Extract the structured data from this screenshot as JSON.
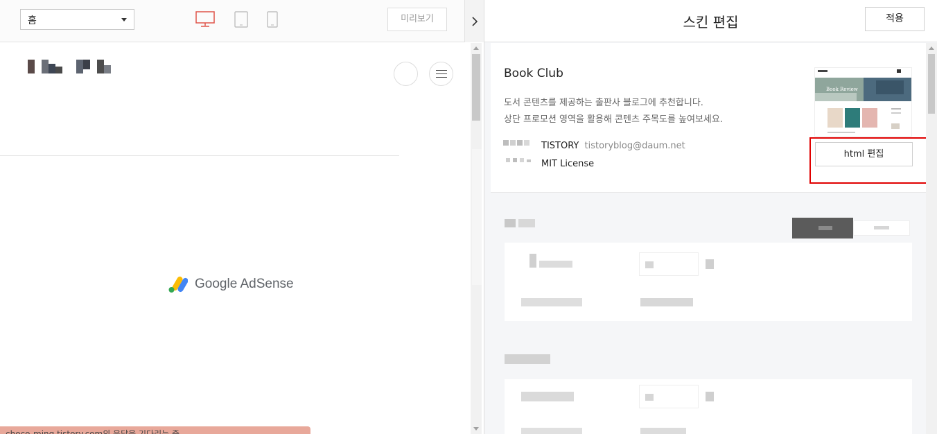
{
  "toolbar": {
    "page_select_value": "홈",
    "preview_label": "미리보기",
    "device_icons": [
      "desktop-icon",
      "tablet-icon",
      "mobile-icon"
    ],
    "active_device_color": "#e0544a",
    "collapse_icon": "chevron-right-icon"
  },
  "preview": {
    "ad_brand": "Google AdSense",
    "toast_text": "choco-ming.tistory.com의 응답을 기다리는 중..."
  },
  "editor": {
    "title": "스킨 편집",
    "apply_label": "적용",
    "skin": {
      "name": "Book Club",
      "description_line1": "도서 콘텐츠를 제공하는 출판사 블로그에 추천합니다.",
      "description_line2": "상단 프로모션 영역을 활용해 콘텐츠 주목도를 높여보세요.",
      "author": "TISTORY",
      "email": "tistoryblog@daum.net",
      "license": "MIT License",
      "html_edit_label": "html 편집",
      "thumbnail_caption": "Book Review"
    },
    "highlight_color": "#e00000"
  }
}
